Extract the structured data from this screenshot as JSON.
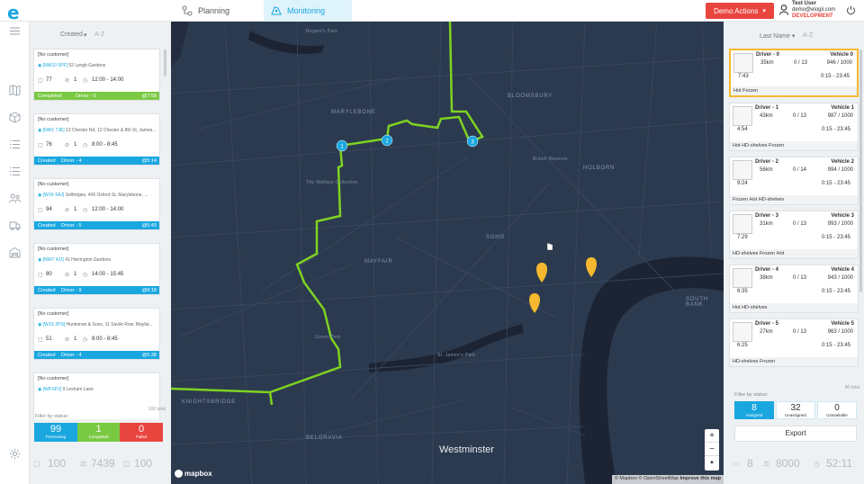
{
  "app": {
    "logo": "e",
    "nav": [
      {
        "label": "Planning"
      },
      {
        "label": "Monitoring"
      }
    ],
    "demo_button": "Demo Actions",
    "user": {
      "name": "Test User",
      "email": "demo@elogii.com",
      "env": "DEVELOPMENT"
    }
  },
  "left_panel": {
    "sort_label": "Created",
    "sort_dir": "A-Z",
    "orders": [
      {
        "customer": "[No customer]",
        "address_ref": "[NW10 5PF]",
        "address": "52 Lyngb Gardens",
        "weight": "77",
        "items": "1",
        "window": "12:00 - 14:00",
        "status": "Completed",
        "driver": "Driver - 0",
        "eta": "@7:58",
        "color": "#7ac943"
      },
      {
        "customer": "[No customer]",
        "address_ref": "[NW1 7JE]",
        "address": "13 Chester Rd, 12 Chester & 8th St, James...",
        "weight": "76",
        "items": "1",
        "window": "8:00 - 8:45",
        "status": "Created",
        "driver": "Driver - 4",
        "eta": "@5:14",
        "color": "#1aa7e0"
      },
      {
        "customer": "[No customer]",
        "address_ref": "[W1K 5AJ]",
        "address": "Selfridges, 400 Oxford St, Marylebone, ...",
        "weight": "94",
        "items": "1",
        "window": "12:00 - 14:00",
        "status": "Created",
        "driver": "Driver - 5",
        "eta": "@5:43",
        "color": "#1aa7e0"
      },
      {
        "customer": "[No customer]",
        "address_ref": "[NW7 4JJ]",
        "address": "41 Harrington Gardens",
        "weight": "80",
        "items": "1",
        "window": "14:00 - 15:45",
        "status": "Created",
        "driver": "Driver - 9",
        "eta": "@8:18",
        "color": "#1aa7e0"
      },
      {
        "customer": "[No customer]",
        "address_ref": "[W1S 2PS]",
        "address": "Huntsman & Sons, 11 Savile Row, Mayfai...",
        "weight": "51",
        "items": "1",
        "window": "8:00 - 8:45",
        "status": "Created",
        "driver": "Driver - 4",
        "eta": "@5:38",
        "color": "#1aa7e0"
      },
      {
        "customer": "[No customer]",
        "address_ref": "[W8 6PJ]",
        "address": "9 Lexham Lane",
        "weight": "",
        "items": "",
        "window": "",
        "status": "",
        "driver": "",
        "eta": "",
        "color": "#ffffff"
      }
    ],
    "filter_label": "Filter by status:",
    "filter_total": "100 total",
    "stats": [
      {
        "count": "99",
        "label": "Processing",
        "color": "#1aa7e0"
      },
      {
        "count": "1",
        "label": "Completed",
        "color": "#7ac943"
      },
      {
        "count": "0",
        "label": "Failed",
        "color": "#e9453f"
      }
    ],
    "bottom": {
      "orders": "100",
      "weight": "7439",
      "items": "100"
    }
  },
  "map": {
    "place_labels": {
      "westminster": "Westminster",
      "marylebone": "MARYLEBONE",
      "bloomsbury": "BLOOMSBURY",
      "holborn": "HOLBORN",
      "soho": "SOHO",
      "mayfair": "MAYFAIR",
      "south_bank": "SOUTH BANK",
      "belgravia": "BELGRAVIA",
      "knightsbridge": "KNIGHTSBRIDGE",
      "british_museum": "British Museum",
      "wallace": "The Wallace Collection",
      "green_park": "Green Park",
      "st_james": "St. James's Park",
      "regents": "Regent's Park"
    },
    "route_stops": [
      "1",
      "2",
      "3"
    ],
    "zoom_in": "+",
    "zoom_out": "−",
    "compass": "▲",
    "mapbox": "mapbox",
    "attribution_1": "© Mapbox © OpenStreetMap",
    "attribution_2": "Improve this map"
  },
  "right_panel": {
    "sort_label": "Last Name",
    "sort_dir": "A-Z",
    "vehicles": [
      {
        "driver": "Driver - 0",
        "vehicle": "Vehicle 0",
        "distance": "35km",
        "stops": "0 / 13",
        "capacity": "946 / 1000",
        "duration": "7:43",
        "window": "0:15 - 23:45",
        "tags": "Hot   Frozen"
      },
      {
        "driver": "Driver - 1",
        "vehicle": "Vehicle 1",
        "distance": "43km",
        "stops": "0 / 13",
        "capacity": "987 / 1000",
        "duration": "4:54",
        "window": "0:15 - 23:45",
        "tags": "Hot   HD-shelves   Frozen"
      },
      {
        "driver": "Driver - 2",
        "vehicle": "Vehicle 2",
        "distance": "56km",
        "stops": "0 / 14",
        "capacity": "994 / 1000",
        "duration": "9:24",
        "window": "0:15 - 23:45",
        "tags": "Frozen   Hot   HD-shelves"
      },
      {
        "driver": "Driver - 3",
        "vehicle": "Vehicle 3",
        "distance": "31km",
        "stops": "0 / 13",
        "capacity": "993 / 1000",
        "duration": "7:29",
        "window": "0:15 - 23:45",
        "tags": "HD-shelves   Frozen   Hot"
      },
      {
        "driver": "Driver - 4",
        "vehicle": "Vehicle 4",
        "distance": "38km",
        "stops": "0 / 13",
        "capacity": "943 / 1000",
        "duration": "6:35",
        "window": "0:15 - 23:45",
        "tags": "Hot   HD-shelves"
      },
      {
        "driver": "Driver - 5",
        "vehicle": "Vehicle 5",
        "distance": "27km",
        "stops": "0 / 13",
        "capacity": "963 / 1000",
        "duration": "6:25",
        "window": "0:15 - 23:45",
        "tags": "HD-shelves   Frozen"
      }
    ],
    "filter_label": "Filter by status:",
    "filter_total": "40 total",
    "stats": [
      {
        "count": "8",
        "label": "Assigned"
      },
      {
        "count": "32",
        "label": "Unassigned"
      },
      {
        "count": "0",
        "label": "Unavailable"
      }
    ],
    "export": "Export",
    "bottom": {
      "vehicles": "8",
      "capacity": "8000",
      "time": "52:11"
    }
  }
}
